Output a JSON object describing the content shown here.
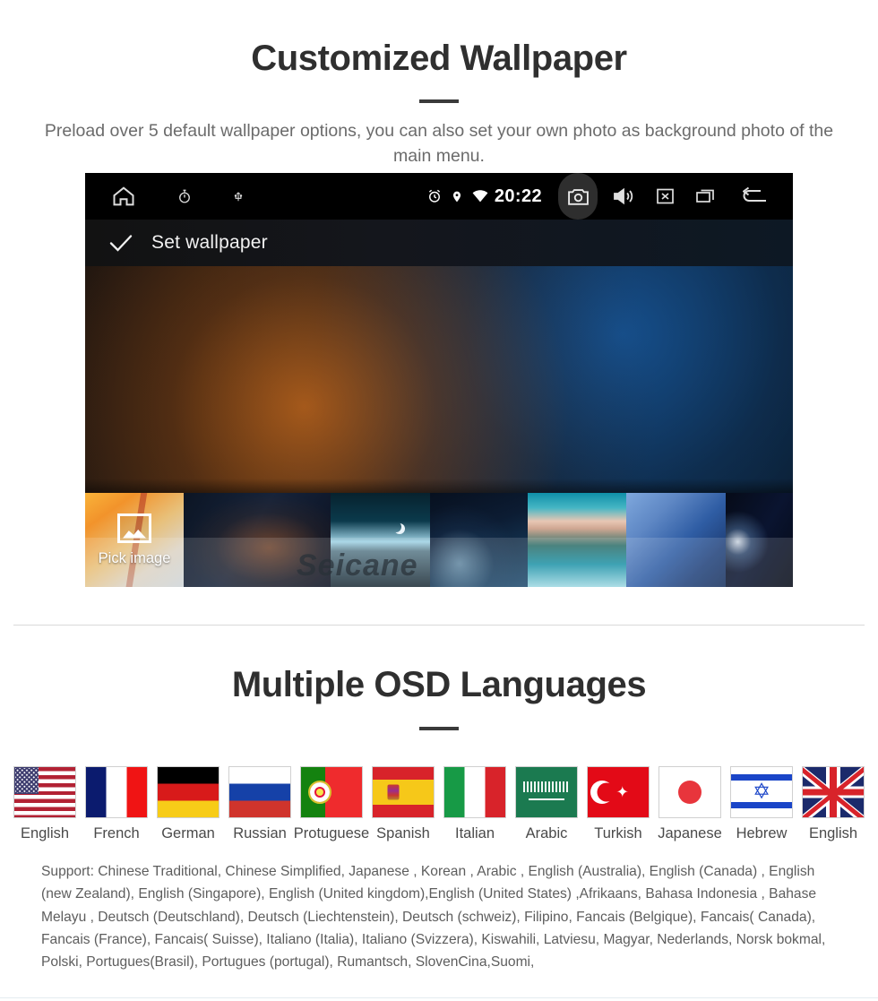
{
  "section1": {
    "title": "Customized Wallpaper",
    "subtitle": "Preload over 5 default wallpaper options, you can also set your own photo as background photo of the main menu."
  },
  "device": {
    "statusbar": {
      "home_icon": "home-icon",
      "timer_icon": "stopwatch-icon",
      "usb_icon": "usb-icon",
      "alarm_icon": "alarm-clock-icon",
      "location_icon": "location-pin-icon",
      "wifi_icon": "wifi-icon",
      "clock": "20:22",
      "camera_icon": "camera-icon",
      "volume_icon": "speaker-volume-icon",
      "close_icon": "close-box-icon",
      "recents_icon": "recent-apps-icon",
      "back_icon": "back-arrow-icon"
    },
    "actionbar": {
      "check_icon": "checkmark-icon",
      "label": "Set wallpaper"
    },
    "thumbnails": [
      {
        "name": "pick-image",
        "label": "Pick image",
        "icon": "image-picker-icon"
      },
      {
        "name": "wallpaper-2",
        "label": ""
      },
      {
        "name": "wallpaper-3",
        "label": ""
      },
      {
        "name": "wallpaper-4",
        "label": ""
      },
      {
        "name": "wallpaper-5",
        "label": ""
      },
      {
        "name": "wallpaper-6",
        "label": ""
      },
      {
        "name": "wallpaper-7",
        "label": ""
      }
    ],
    "watermark": "Seicane"
  },
  "section2": {
    "title": "Multiple OSD Languages",
    "flags": [
      {
        "code": "us",
        "label": "English"
      },
      {
        "code": "fr",
        "label": "French"
      },
      {
        "code": "de",
        "label": "German"
      },
      {
        "code": "ru",
        "label": "Russian"
      },
      {
        "code": "pt",
        "label": "Protuguese"
      },
      {
        "code": "es",
        "label": "Spanish"
      },
      {
        "code": "it",
        "label": "Italian"
      },
      {
        "code": "sa",
        "label": "Arabic"
      },
      {
        "code": "tr",
        "label": "Turkish"
      },
      {
        "code": "jp",
        "label": "Japanese"
      },
      {
        "code": "il",
        "label": "Hebrew"
      },
      {
        "code": "gb",
        "label": "English"
      }
    ],
    "support_text": "Support: Chinese Traditional, Chinese Simplified, Japanese , Korean , Arabic , English (Australia), English (Canada) , English (new Zealand), English (Singapore), English (United kingdom),English (United States) ,Afrikaans, Bahasa Indonesia , Bahase Melayu , Deutsch (Deutschland), Deutsch (Liechtenstein), Deutsch (schweiz), Filipino, Fancais (Belgique), Fancais( Canada), Fancais (France), Fancais( Suisse), Italiano (Italia), Italiano (Svizzera), Kiswahili, Latviesu, Magyar, Nederlands, Norsk bokmal, Polski, Portugues(Brasil), Portugues (portugal), Rumantsch, SlovenCina,Suomi,"
  }
}
